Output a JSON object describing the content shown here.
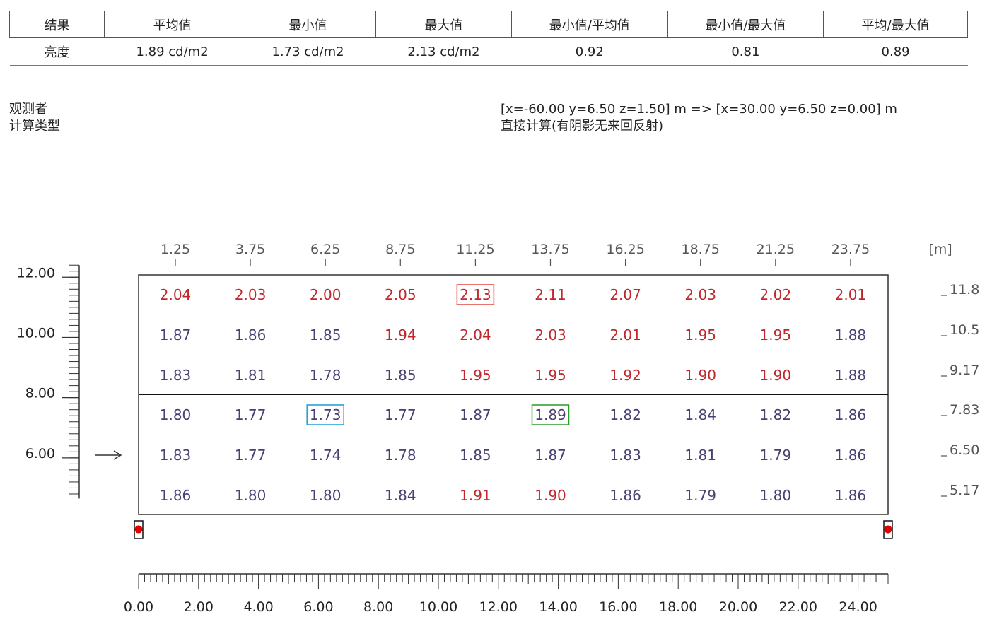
{
  "results_table": {
    "headers": [
      "结果",
      "平均值",
      "最小值",
      "最大值",
      "最小值/平均值",
      "最小值/最大值",
      "平均/最大值"
    ],
    "row": [
      "亮度",
      "1.89 cd/m2",
      "1.73 cd/m2",
      "2.13 cd/m2",
      "0.92",
      "0.81",
      "0.89"
    ]
  },
  "info": {
    "observer_label": "观测者",
    "calc_type_label": "计算类型",
    "observer_value": "[x=-60.00 y=6.50 z=1.50] m => [x=30.00 y=6.50 z=0.00] m",
    "calc_type_value": "直接计算(有阴影无来回反射)"
  },
  "grid": {
    "x_tick_labels": [
      "1.25",
      "3.75",
      "6.25",
      "8.75",
      "11.25",
      "13.75",
      "16.25",
      "18.75",
      "21.25",
      "23.75"
    ],
    "unit_label": "[m]",
    "right_labels": [
      "11.8",
      "10.5",
      "9.17",
      "7.83",
      "6.50",
      "5.17"
    ],
    "left_axis_labels": [
      "12.00",
      "10.00",
      "8.00",
      "6.00"
    ],
    "bottom_axis_labels": [
      "0.00",
      "2.00",
      "4.00",
      "6.00",
      "8.00",
      "10.00",
      "12.00",
      "14.00",
      "16.00",
      "18.00",
      "20.00",
      "22.00",
      "24.00"
    ],
    "values": [
      [
        "2.04",
        "2.03",
        "2.00",
        "2.05",
        "2.13",
        "2.11",
        "2.07",
        "2.03",
        "2.02",
        "2.01"
      ],
      [
        "1.87",
        "1.86",
        "1.85",
        "1.94",
        "2.04",
        "2.03",
        "2.01",
        "1.95",
        "1.95",
        "1.88"
      ],
      [
        "1.83",
        "1.81",
        "1.78",
        "1.85",
        "1.95",
        "1.95",
        "1.92",
        "1.90",
        "1.90",
        "1.88"
      ],
      [
        "1.80",
        "1.77",
        "1.73",
        "1.77",
        "1.87",
        "1.89",
        "1.82",
        "1.84",
        "1.82",
        "1.86"
      ],
      [
        "1.83",
        "1.77",
        "1.74",
        "1.78",
        "1.85",
        "1.87",
        "1.83",
        "1.81",
        "1.79",
        "1.86"
      ],
      [
        "1.86",
        "1.80",
        "1.80",
        "1.84",
        "1.91",
        "1.90",
        "1.86",
        "1.79",
        "1.80",
        "1.86"
      ]
    ],
    "highlight_threshold": 1.9,
    "max_cell": {
      "row": 0,
      "col": 4
    },
    "min_cell": {
      "row": 3,
      "col": 2
    },
    "avg_cell": {
      "row": 3,
      "col": 5
    },
    "colors": {
      "high": "#c0262b",
      "normal": "#4b3f72",
      "max_box": "#e0443a",
      "min_box": "#1e9ad6",
      "avg_box": "#2c9b2c",
      "marker": "#e00000"
    }
  }
}
